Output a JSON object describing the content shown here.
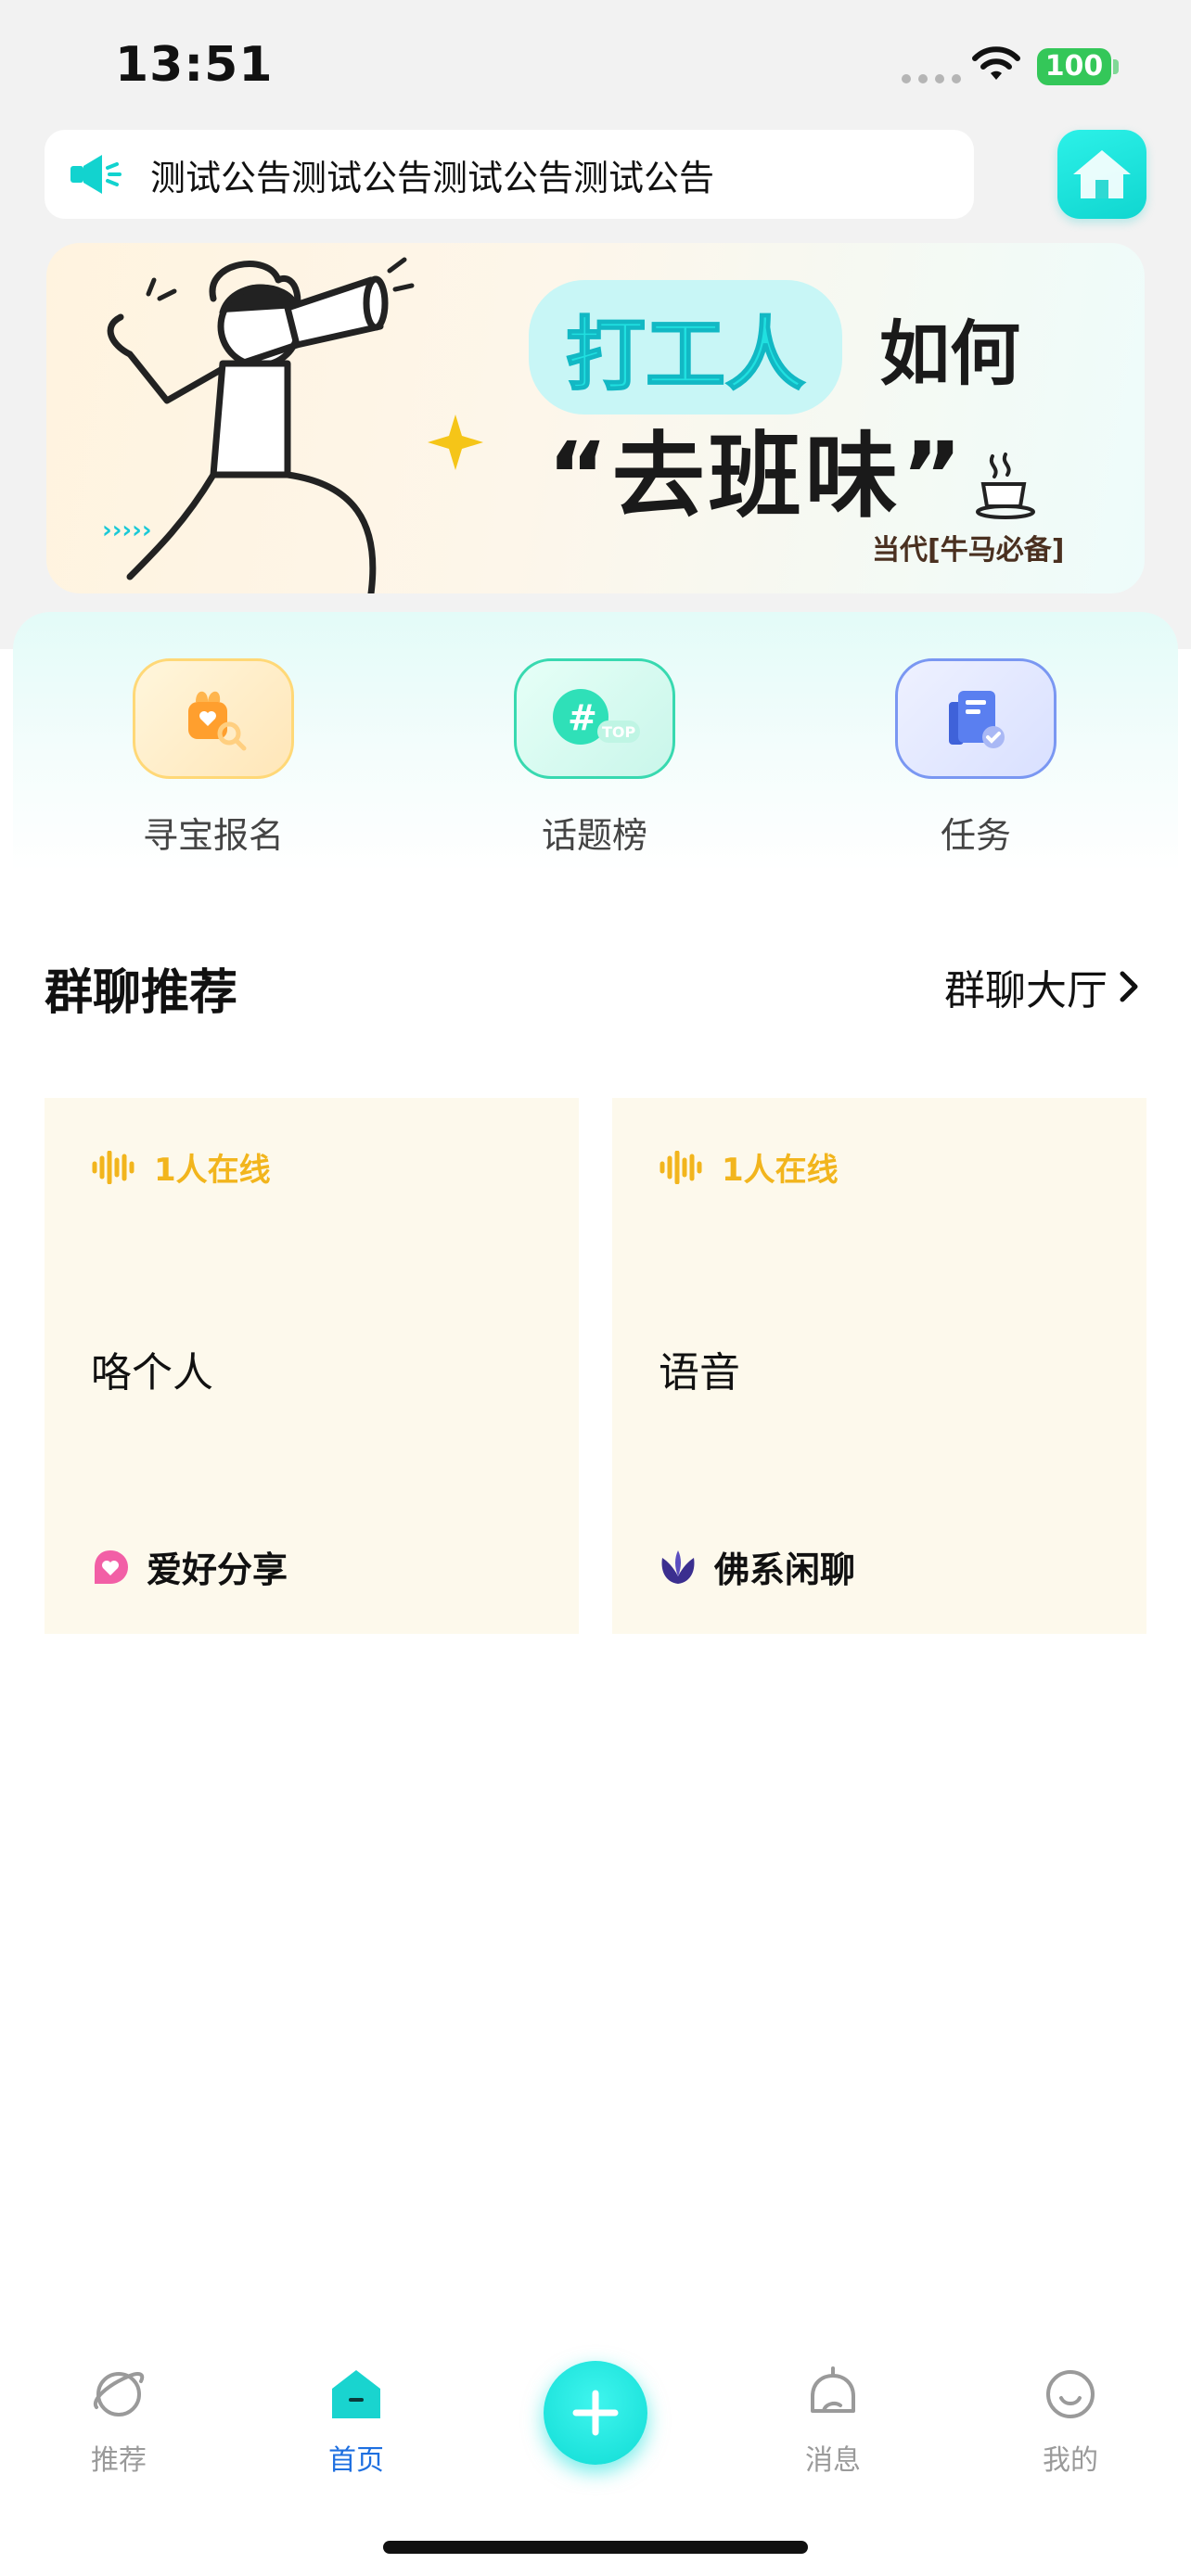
{
  "status_bar": {
    "time": "13:51",
    "battery": "100"
  },
  "announcement": {
    "text": "测试公告测试公告测试公告测试公告"
  },
  "banner": {
    "title_highlight": "打工人",
    "title_rest": "如何",
    "headline": "“去班味”",
    "tagline": "当代[牛马必备]"
  },
  "quick_entries": [
    {
      "label": "寻宝报名",
      "icon": "treasure-search-icon"
    },
    {
      "label": "话题榜",
      "icon": "hashtag-top-icon"
    },
    {
      "label": "任务",
      "icon": "task-document-icon"
    }
  ],
  "section": {
    "title": "群聊推荐",
    "more_label": "群聊大厅"
  },
  "group_cards": [
    {
      "online": "1人在线",
      "name": "咯个人",
      "tag": "爱好分享",
      "tag_icon": "heart-bubble-icon"
    },
    {
      "online": "1人在线",
      "name": "语音",
      "tag": "佛系闲聊",
      "tag_icon": "lotus-icon"
    }
  ],
  "tab_bar": {
    "tabs": [
      {
        "label": "推荐",
        "icon": "planet-icon",
        "active": false
      },
      {
        "label": "首页",
        "icon": "home-tab-icon",
        "active": true
      },
      {
        "label": "消息",
        "icon": "bell-icon",
        "active": false
      },
      {
        "label": "我的",
        "icon": "smile-face-icon",
        "active": false
      }
    ],
    "add_icon": "plus-icon"
  },
  "colors": {
    "accent": "#10d6d0",
    "active_tab": "#1e6fe0",
    "online": "#f2b51d",
    "card_bg": "#fdf9ec"
  }
}
